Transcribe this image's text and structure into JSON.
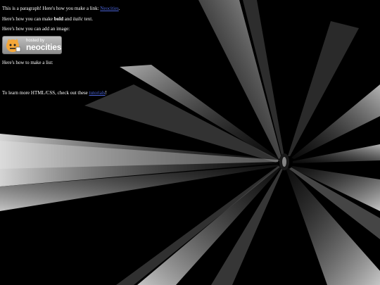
{
  "paragraph": {
    "text_before": "This is a paragraph! Here's how you make a link: ",
    "link_label": "Neocities",
    "text_after": "."
  },
  "formatting": {
    "text_before": "Here's how you can make ",
    "bold_label": "bold",
    "text_middle": " and ",
    "italic_label": "italic",
    "text_after": " text."
  },
  "image_intro": "Here's how you can add an image:",
  "badge": {
    "hosted_by": "hosted by",
    "name": "neocities"
  },
  "list_intro": "Here's how to make a list:",
  "learn_more": {
    "text_before": "To learn more HTML/CSS, check out these ",
    "link_label": "tutorials",
    "text_after": "!"
  },
  "colors": {
    "background": "#000000",
    "text": "#ffffff",
    "link": "#4a63d6",
    "beam_light": "#d8d8d8",
    "beam_mid": "#8a8a8a"
  },
  "icons": {
    "badge_mascot": "neocities-cat-icon"
  }
}
